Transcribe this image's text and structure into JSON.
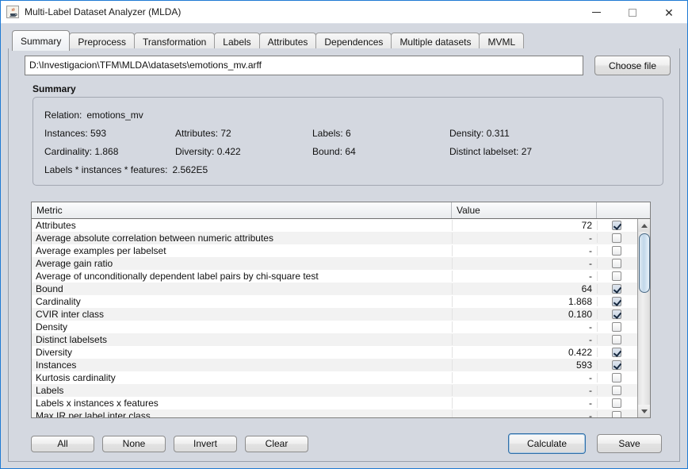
{
  "window": {
    "title": "Multi-Label Dataset Analyzer (MLDA)",
    "icon": "java-cup-icon",
    "minimize_label": "—",
    "maximize_label": "",
    "close_label": "✕",
    "border_color": "#1f7ad4"
  },
  "tabs": [
    {
      "label": "Summary",
      "active": true
    },
    {
      "label": "Preprocess",
      "active": false
    },
    {
      "label": "Transformation",
      "active": false
    },
    {
      "label": "Labels",
      "active": false
    },
    {
      "label": "Attributes",
      "active": false
    },
    {
      "label": "Dependences",
      "active": false
    },
    {
      "label": "Multiple datasets",
      "active": false
    },
    {
      "label": "MVML",
      "active": false
    }
  ],
  "file_row": {
    "path_value": "D:\\Investigacion\\TFM\\MLDA\\datasets\\emotions_mv.arff",
    "path_placeholder": "",
    "choose_button": "Choose file"
  },
  "summary": {
    "group_title": "Summary",
    "relation_label": "Relation:",
    "relation_value": "emotions_mv",
    "rows": [
      [
        {
          "label": "Instances:",
          "value": "593"
        },
        {
          "label": "Attributes:",
          "value": "72"
        },
        {
          "label": "Labels:",
          "value": "6"
        },
        {
          "label": "Density:",
          "value": "0.311"
        }
      ],
      [
        {
          "label": "Cardinality:",
          "value": "1.868"
        },
        {
          "label": "Diversity:",
          "value": "0.422"
        },
        {
          "label": "Bound:",
          "value": "64"
        },
        {
          "label": "Distinct labelset:",
          "value": "27"
        }
      ]
    ],
    "lif_label": "Labels * instances * features:",
    "lif_value": "2.562E5"
  },
  "table": {
    "columns": [
      "Metric",
      "Value",
      ""
    ],
    "rows": [
      {
        "metric": "Attributes",
        "value": "72",
        "checked": true
      },
      {
        "metric": "Average absolute correlation between numeric attributes",
        "value": "-",
        "checked": false
      },
      {
        "metric": "Average examples per labelset",
        "value": "-",
        "checked": false
      },
      {
        "metric": "Average gain ratio",
        "value": "-",
        "checked": false
      },
      {
        "metric": "Average of unconditionally dependent label pairs by chi-square test",
        "value": "-",
        "checked": false
      },
      {
        "metric": "Bound",
        "value": "64",
        "checked": true
      },
      {
        "metric": "Cardinality",
        "value": "1.868",
        "checked": true
      },
      {
        "metric": "CVIR inter class",
        "value": "0.180",
        "checked": true
      },
      {
        "metric": "Density",
        "value": "-",
        "checked": false
      },
      {
        "metric": "Distinct labelsets",
        "value": "-",
        "checked": false
      },
      {
        "metric": "Diversity",
        "value": "0.422",
        "checked": true
      },
      {
        "metric": "Instances",
        "value": "593",
        "checked": true
      },
      {
        "metric": "Kurtosis cardinality",
        "value": "-",
        "checked": false
      },
      {
        "metric": "Labels",
        "value": "-",
        "checked": false
      },
      {
        "metric": "Labels x instances x features",
        "value": "-",
        "checked": false
      },
      {
        "metric": "Max IR per label inter class",
        "value": "-",
        "checked": false
      }
    ],
    "scrollbar": {
      "up_arrow": "scroll-up-icon",
      "down_arrow": "scroll-down-icon"
    }
  },
  "footer": {
    "all_label": "All",
    "none_label": "None",
    "invert_label": "Invert",
    "clear_label": "Clear",
    "calculate_label": "Calculate",
    "save_label": "Save"
  }
}
